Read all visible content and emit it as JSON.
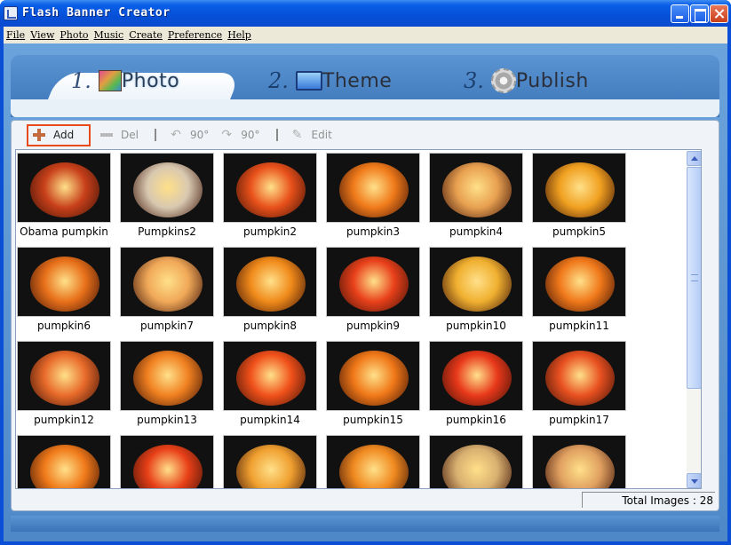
{
  "window": {
    "title": "Flash Banner Creator"
  },
  "menu": [
    "File",
    "View",
    "Photo",
    "Music",
    "Create",
    "Preference",
    "Help"
  ],
  "tabs": [
    {
      "number": "1.",
      "label": "Photo",
      "icon": "photo-icon",
      "active": true
    },
    {
      "number": "2.",
      "label": "Theme",
      "icon": "monitor-icon",
      "active": false
    },
    {
      "number": "3.",
      "label": "Publish",
      "icon": "gear-icon",
      "active": false
    }
  ],
  "toolbar": {
    "add": "Add",
    "del": "Del",
    "rotate_left": "90°",
    "rotate_right": "90°",
    "edit": "Edit"
  },
  "images": [
    {
      "caption": "Obama pumpkin",
      "color": "#c8401a"
    },
    {
      "caption": "Pumpkins2",
      "color": "#d8c8b0"
    },
    {
      "caption": "pumpkin2",
      "color": "#e8501a"
    },
    {
      "caption": "pumpkin3",
      "color": "#f07a1a"
    },
    {
      "caption": "pumpkin4",
      "color": "#e8a050"
    },
    {
      "caption": "pumpkin5",
      "color": "#f0a020"
    },
    {
      "caption": "pumpkin6",
      "color": "#e8701a"
    },
    {
      "caption": "pumpkin7",
      "color": "#f0a858"
    },
    {
      "caption": "pumpkin8",
      "color": "#f08a1a"
    },
    {
      "caption": "pumpkin9",
      "color": "#e8401a"
    },
    {
      "caption": "pumpkin10",
      "color": "#f0b030"
    },
    {
      "caption": "pumpkin11",
      "color": "#f0781a"
    },
    {
      "caption": "pumpkin12",
      "color": "#e86a2a"
    },
    {
      "caption": "pumpkin13",
      "color": "#f08020"
    },
    {
      "caption": "pumpkin14",
      "color": "#f0501a"
    },
    {
      "caption": "pumpkin15",
      "color": "#f07818"
    },
    {
      "caption": "pumpkin16",
      "color": "#e8381a"
    },
    {
      "caption": "pumpkin17",
      "color": "#e85020"
    },
    {
      "caption": "",
      "color": "#f07a1a"
    },
    {
      "caption": "",
      "color": "#e84018"
    },
    {
      "caption": "",
      "color": "#f0a030"
    },
    {
      "caption": "",
      "color": "#f08a20"
    },
    {
      "caption": "",
      "color": "#d8b070"
    },
    {
      "caption": "",
      "color": "#e0a060"
    }
  ],
  "status": {
    "total_images": "Total Images : 28"
  }
}
